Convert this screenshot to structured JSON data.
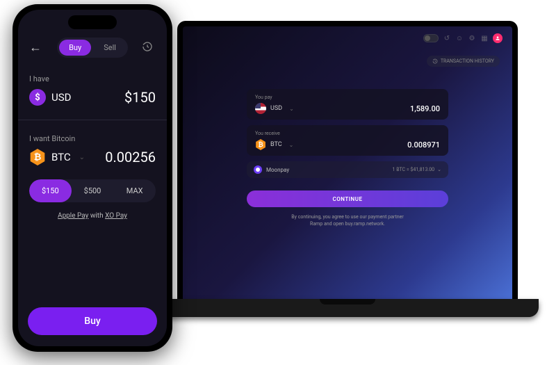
{
  "mobile": {
    "tabs": {
      "buy": "Buy",
      "sell": "Sell"
    },
    "i_have_label": "I have",
    "have_currency": "USD",
    "have_amount": "$150",
    "i_want_label": "I want Bitcoin",
    "want_currency": "BTC",
    "want_amount": "0.00256",
    "presets": [
      "$150",
      "$500",
      "MAX"
    ],
    "pay_prefix": "Apple Pay",
    "pay_mid": " with ",
    "pay_suffix": "XO Pay",
    "buy_button": "Buy"
  },
  "desktop": {
    "tx_history": "TRANSACTION HISTORY",
    "pay_label": "You pay",
    "pay_currency": "USD",
    "pay_amount": "1,589.00",
    "receive_label": "You receive",
    "receive_currency": "BTC",
    "receive_amount": "0.008971",
    "provider": "Moonpay",
    "rate": "1 BTC = $41,813.00",
    "continue": "CONTINUE",
    "disclaimer_l1": "By continuing, you agree to use our payment partner",
    "disclaimer_l2": "Ramp and open buy.ramp.network."
  }
}
